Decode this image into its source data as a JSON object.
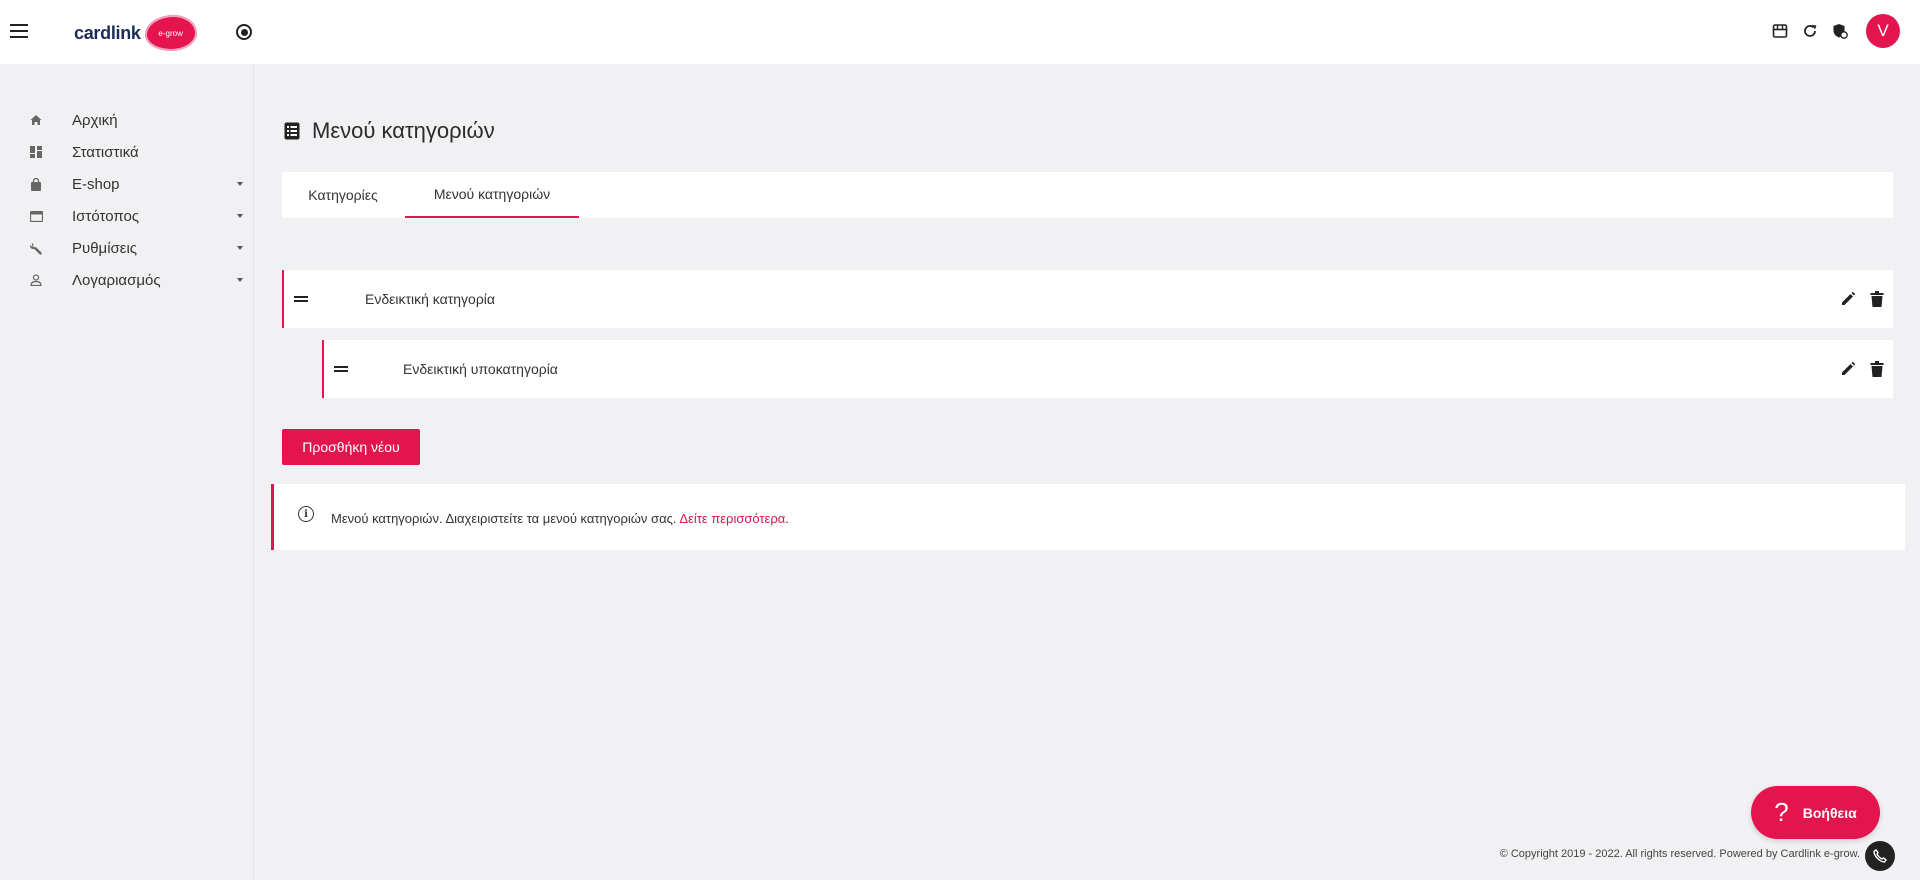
{
  "header": {
    "logo_text": "cardlink",
    "logo_badge": "e-grow",
    "avatar_initial": "V",
    "icons": [
      "menu-icon",
      "radio-button-icon",
      "store-icon",
      "refresh-icon",
      "shield-icon"
    ]
  },
  "sidebar": {
    "items": [
      {
        "label": "Αρχική",
        "icon": "home-icon",
        "has_submenu": false
      },
      {
        "label": "Στατιστικά",
        "icon": "dashboard-icon",
        "has_submenu": false
      },
      {
        "label": "E-shop",
        "icon": "shopping-bag-icon",
        "has_submenu": true
      },
      {
        "label": "Ιστότοπος",
        "icon": "website-icon",
        "has_submenu": true
      },
      {
        "label": "Ρυθμίσεις",
        "icon": "wrench-icon",
        "has_submenu": true
      },
      {
        "label": "Λογαριασμός",
        "icon": "user-icon",
        "has_submenu": true
      }
    ]
  },
  "main": {
    "title": "Μενού κατηγοριών",
    "tabs": [
      {
        "label": "Κατηγορίες",
        "active": false
      },
      {
        "label": "Μενού κατηγοριών",
        "active": true
      }
    ],
    "menu_items": [
      {
        "label": "Ενδεικτική κατηγορία",
        "level": 0
      },
      {
        "label": "Ενδεικτική υποκατηγορία",
        "level": 1
      }
    ],
    "add_button": "Προσθήκη νέου",
    "info": {
      "text": "Μενού κατηγοριών. Διαχειριστείτε τα μενού κατηγοριών σας.",
      "link": "Δείτε περισσότερα",
      "suffix": "."
    }
  },
  "help": {
    "label": "Βοήθεια",
    "icon_glyph": "?"
  },
  "footer": {
    "copyright": "© Copyright 2019 - 2022. All rights reserved. Powered by Cardlink e-grow."
  },
  "colors": {
    "accent": "#e4144f",
    "background": "#f1f1f4",
    "surface": "#ffffff",
    "text": "#2b2b2b"
  }
}
